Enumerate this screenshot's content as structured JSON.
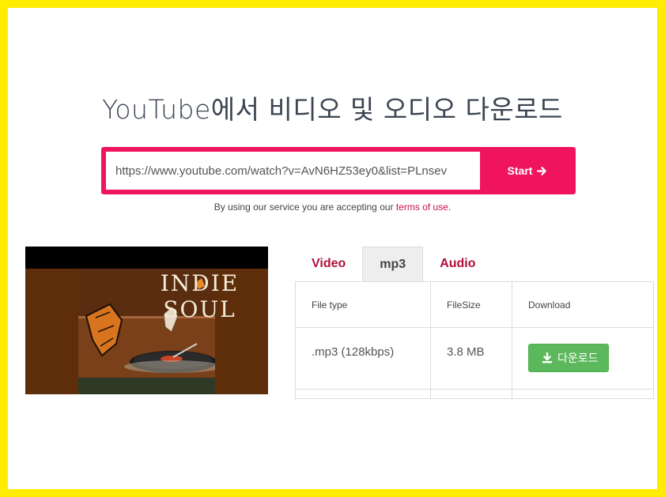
{
  "header": {
    "title": "YouTube에서 비디오 및 오디오 다운로드"
  },
  "form": {
    "url_value": "https://www.youtube.com/watch?v=AvN6HZ53ey0&list=PLnsev",
    "start_label": "Start"
  },
  "terms": {
    "prefix": "By using our service you are accepting our ",
    "link": "terms of use",
    "suffix": "."
  },
  "thumbnail": {
    "album_title": "INDIE SOUL"
  },
  "tabs": [
    {
      "label": "Video",
      "active": false
    },
    {
      "label": "mp3",
      "active": true
    },
    {
      "label": "Audio",
      "active": false
    }
  ],
  "table": {
    "headers": [
      "File type",
      "FileSize",
      "Download"
    ],
    "rows": [
      {
        "file_type": ".mp3 (128kbps)",
        "file_size": "3.8 MB",
        "download_label": "다운로드"
      }
    ]
  },
  "colors": {
    "accent": "#f0145f",
    "link": "#c81050",
    "download_green": "#5cb85c"
  },
  "icons": {
    "start": "arrow-right-icon",
    "download": "download-icon"
  }
}
